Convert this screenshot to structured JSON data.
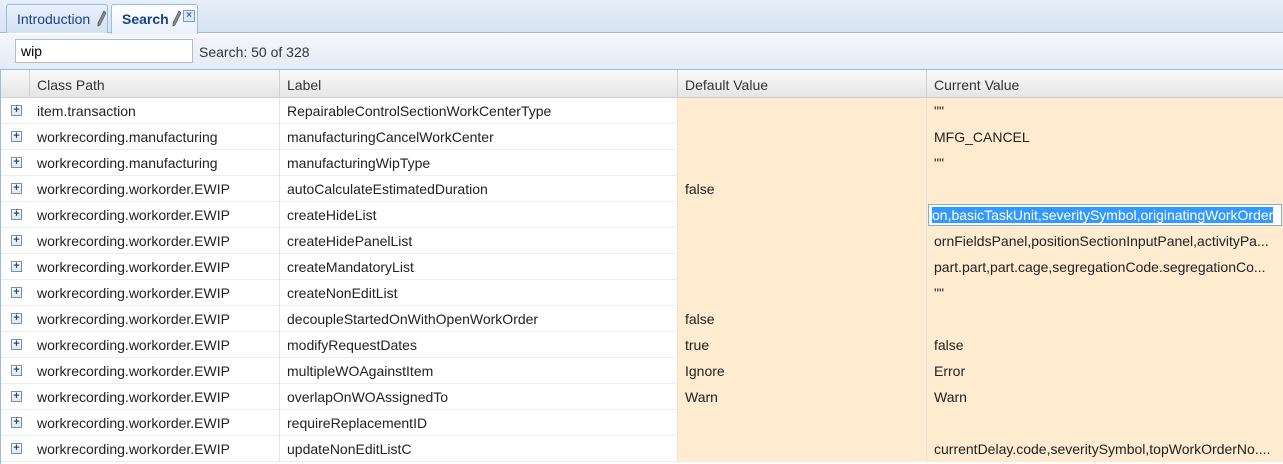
{
  "tabs": [
    {
      "label": "Introduction",
      "active": false
    },
    {
      "label": "Search",
      "active": true
    }
  ],
  "search": {
    "value": "wip",
    "status": "Search: 50 of 328"
  },
  "grid": {
    "columns": [
      "Class Path",
      "Label",
      "Default Value",
      "Current Value"
    ],
    "rows": [
      {
        "class_path": "item.transaction",
        "label": "RepairableControlSectionWorkCenterType",
        "default": "",
        "current": "\"\""
      },
      {
        "class_path": "workrecording.manufacturing",
        "label": "manufacturingCancelWorkCenter",
        "default": "",
        "current": "MFG_CANCEL"
      },
      {
        "class_path": "workrecording.manufacturing",
        "label": "manufacturingWipType",
        "default": "",
        "current": "\"\""
      },
      {
        "class_path": "workrecording.workorder.EWIP",
        "label": "autoCalculateEstimatedDuration",
        "default": "false",
        "current": ""
      },
      {
        "class_path": "workrecording.workorder.EWIP",
        "label": "createHideList",
        "default": "",
        "current": "on,basicTaskUnit,severitySymbol,originatingWorkOrder"
      },
      {
        "class_path": "workrecording.workorder.EWIP",
        "label": "createHidePanelList",
        "default": "",
        "current": "ornFieldsPanel,positionSectionInputPanel,activityPa..."
      },
      {
        "class_path": "workrecording.workorder.EWIP",
        "label": "createMandatoryList",
        "default": "",
        "current": "part.part,part.cage,segregationCode.segregationCo..."
      },
      {
        "class_path": "workrecording.workorder.EWIP",
        "label": "createNonEditList",
        "default": "",
        "current": "\"\""
      },
      {
        "class_path": "workrecording.workorder.EWIP",
        "label": "decoupleStartedOnWithOpenWorkOrder",
        "default": "false",
        "current": ""
      },
      {
        "class_path": "workrecording.workorder.EWIP",
        "label": "modifyRequestDates",
        "default": "true",
        "current": "false"
      },
      {
        "class_path": "workrecording.workorder.EWIP",
        "label": "multipleWOAgainstItem",
        "default": "Ignore",
        "current": "Error"
      },
      {
        "class_path": "workrecording.workorder.EWIP",
        "label": "overlapOnWOAssignedTo",
        "default": "Warn",
        "current": "Warn"
      },
      {
        "class_path": "workrecording.workorder.EWIP",
        "label": "requireReplacementID",
        "default": "",
        "current": ""
      },
      {
        "class_path": "workrecording.workorder.EWIP",
        "label": "updateNonEditListC",
        "default": "",
        "current": "currentDelay.code,severitySymbol,topWorkOrderNo...."
      }
    ],
    "selected_row": 4
  },
  "colors": {
    "editable_cell": "#feebd0",
    "tab_text": "#15428b",
    "border": "#99bbe8"
  },
  "icons": {
    "expander": "plus-box",
    "tab_edit": "pencil",
    "tab_close": "close-x"
  }
}
